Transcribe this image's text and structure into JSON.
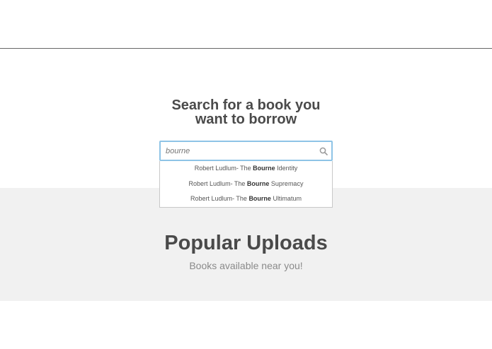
{
  "hero": {
    "title_line1": "Search for a book you",
    "title_line2": "want to borrow"
  },
  "search": {
    "value": "bourne",
    "icon": "search-icon"
  },
  "suggestions": [
    {
      "prefix": "Robert Ludlum- The ",
      "match": "Bourne",
      "suffix": " Identity"
    },
    {
      "prefix": "Robert Ludlum- The ",
      "match": "Bourne",
      "suffix": " Supremacy"
    },
    {
      "prefix": "Robert Ludlum- The ",
      "match": "Bourne",
      "suffix": " Ultimatum"
    }
  ],
  "popular": {
    "title": "Popular Uploads",
    "subtitle": "Books available near you!"
  },
  "colors": {
    "input_focus_border": "#8ec4e6",
    "popular_background": "#f1f1f1",
    "heading_text": "#4a4a4a"
  }
}
